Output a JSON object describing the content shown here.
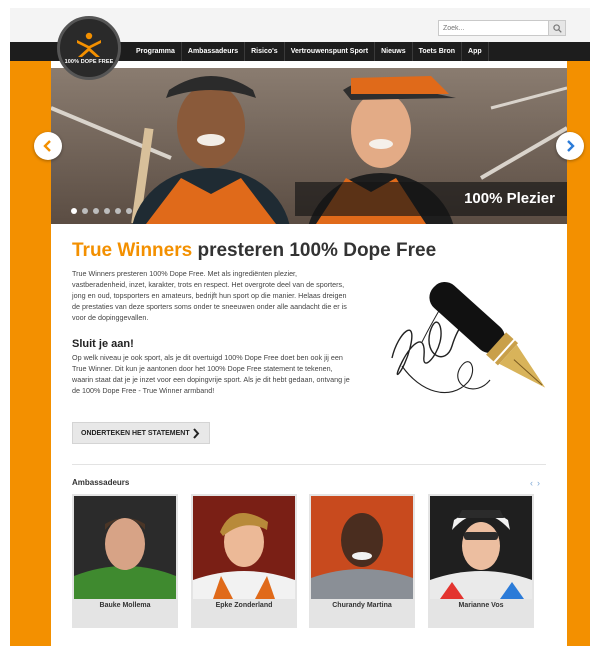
{
  "search": {
    "placeholder": "Zoek..."
  },
  "logo": {
    "text": "100% DOPE FREE"
  },
  "nav": {
    "items": [
      {
        "label": "Programma"
      },
      {
        "label": "Ambassadeurs"
      },
      {
        "label": "Risico's"
      },
      {
        "label": "Vertrouwenspunt Sport"
      },
      {
        "label": "Nieuws"
      },
      {
        "label": "Toets Bron"
      },
      {
        "label": "App"
      }
    ]
  },
  "hero": {
    "caption": "100% Plezier",
    "slide_count": 6,
    "active_slide": 1
  },
  "headline": {
    "accent": "True Winners",
    "rest": " presteren 100% Dope Free"
  },
  "intro": "True Winners presteren 100% Dope Free. Met als ingrediënten plezier, vastberadenheid, inzet, karakter, trots en respect. Het overgrote deel van de sporters, jong en oud, topsporters en amateurs, bedrijft hun sport op die manier. Helaas dreigen de prestaties van deze sporters soms onder te sneeuwen onder alle aandacht die er is voor de dopinggevallen.",
  "join": {
    "title": "Sluit je aan!",
    "text": "Op welk niveau je ook sport, als je dit overtuigd 100% Dope Free doet ben ook jij een True Winner. Dit kun je aantonen door het 100% Dope Free statement te tekenen, waarin staat dat je je inzet voor een dopingvrije sport. Als je dit hebt gedaan, ontvang je de 100% Dope Free - True Winner armband!"
  },
  "cta": {
    "label": "ONDERTEKEN HET STATEMENT"
  },
  "ambassadors": {
    "title": "Ambassadeurs",
    "items": [
      {
        "name": "Bauke Mollema"
      },
      {
        "name": "Epke Zonderland"
      },
      {
        "name": "Churandy Martina"
      },
      {
        "name": "Marianne Vos"
      }
    ]
  },
  "colors": {
    "accent": "#f39000",
    "nav_bg": "#1d1d1d",
    "link_blue": "#2b7bd8"
  }
}
